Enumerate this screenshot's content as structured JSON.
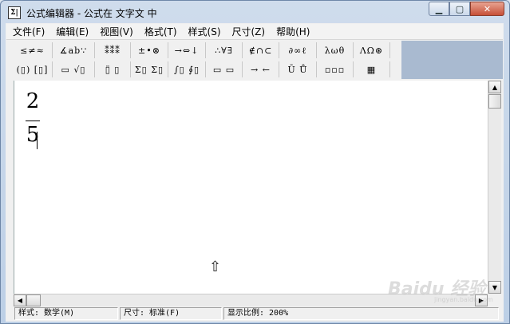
{
  "window": {
    "title": "公式编辑器 - 公式在 文字文 中",
    "app_icon": "Σ|",
    "min_glyph": "▁",
    "max_glyph": "▢",
    "close_glyph": "✕"
  },
  "menu": {
    "items": [
      "文件(F)",
      "编辑(E)",
      "视图(V)",
      "格式(T)",
      "样式(S)",
      "尺寸(Z)",
      "帮助(H)"
    ]
  },
  "toolbar": {
    "row1": [
      "≤≠≈",
      "∡ab∵",
      "⁑⁑⁑",
      "±•⊗",
      "→⇔↓",
      "∴∀∃",
      "∉∩⊂",
      "∂∞ℓ",
      "λωθ",
      "ΛΩ⊛"
    ],
    "row2": [
      "(▯) [▯]",
      "▭ √▯",
      "▯̈ ▯",
      "Σ▯ Σ▯",
      "∫▯ ∮▯",
      "▭ ▭",
      "→ ←",
      "Ū Ů",
      "▫▫▫",
      "▦"
    ]
  },
  "document": {
    "numerator": "2",
    "denominator": "5",
    "cursor_glyph": "⇧"
  },
  "scrollbars": {
    "up": "▲",
    "down": "▼",
    "left": "◀",
    "right": "▶"
  },
  "status": {
    "style": "样式: 数学(M)",
    "size": "尺寸: 标准(F)",
    "zoom": "显示比例: 200%"
  },
  "watermark": {
    "main": "Baidu 经验",
    "sub": "jingyan.baidu.com"
  },
  "colors": {
    "title_bg": "#c7d6ea",
    "toolbar_right": "#a9bad0",
    "close_button": "#c75038"
  }
}
